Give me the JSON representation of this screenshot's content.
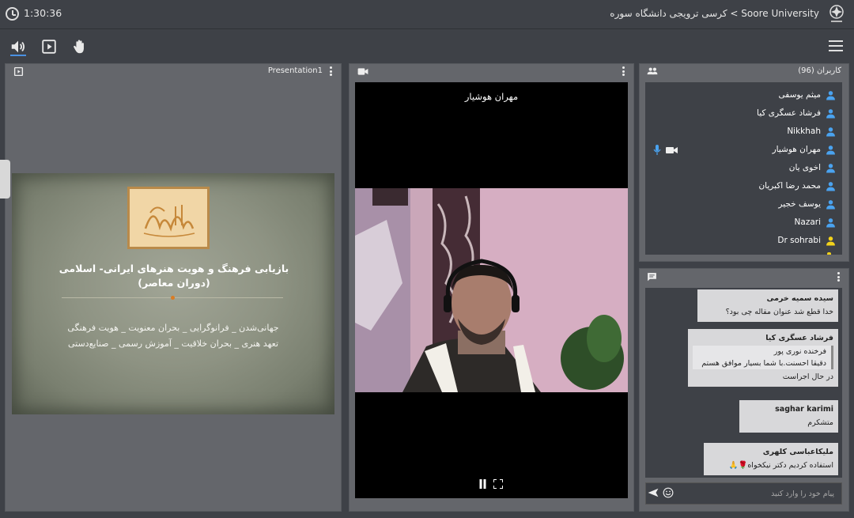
{
  "header": {
    "timer": "1:30:36",
    "room_title": "Soore University > کرسی ترویجی دانشگاه سوره"
  },
  "presentation": {
    "title": "Presentation1",
    "slide_title_line1": "بازیابی فرهنگ و هویت هنرهای ایرانی- اسلامی",
    "slide_title_line2": "(دوران معاصر)",
    "slide_body_line1": "جهانی‌شدن _ فرانوگرایی _ بحران معنویت _ هویت فرهنگی",
    "slide_body_line2": "تعهد هنری _ بحران خلاقیت _ آموزش رسمی _ صنایع‌دستی",
    "calligraphy": "هوالله"
  },
  "video": {
    "speaker_name": "مهران هوشیار"
  },
  "users": {
    "title": "کاربران (96)",
    "items": [
      {
        "name": "میثم یوسفی",
        "color": "#4aa3f0"
      },
      {
        "name": "فرشاد عسگری کیا",
        "color": "#4aa3f0"
      },
      {
        "name": "Nikkhah",
        "color": "#4aa3f0"
      },
      {
        "name": "مهران هوشیار",
        "color": "#4aa3f0"
      },
      {
        "name": "اخوی یان",
        "color": "#4aa3f0"
      },
      {
        "name": "محمد رضا اکبریان",
        "color": "#4aa3f0"
      },
      {
        "name": "یوسف خجیر",
        "color": "#4aa3f0"
      },
      {
        "name": "Nazari",
        "color": "#4aa3f0"
      },
      {
        "name": "Dr sohrabi",
        "color": "#f2d21b"
      }
    ]
  },
  "chat": {
    "messages": [
      {
        "sender": "سیده سمیه خرمی",
        "lines": [
          "خدا قطع شد عنوان مقاله چی بود؟"
        ]
      },
      {
        "sender": "فرشاد عسگری کیا",
        "quote": [
          "فرخنده نوری پور",
          "دقیقا احسنت.با شما بسیار موافق هستم"
        ],
        "lines": [
          "در حال اجراست"
        ]
      },
      {
        "sender": "saghar karimi",
        "lines": [
          "متشکرم"
        ]
      },
      {
        "sender": "ملیکاعباسی کلهری",
        "lines": [
          "استفاده کردیم دکتر نیکخواه🌹🙏"
        ]
      }
    ],
    "input_placeholder": "پیام خود را وارد کنید"
  },
  "colors": {
    "accent": "#4a90e2",
    "panel": "#64666b",
    "background": "#3e4147"
  }
}
